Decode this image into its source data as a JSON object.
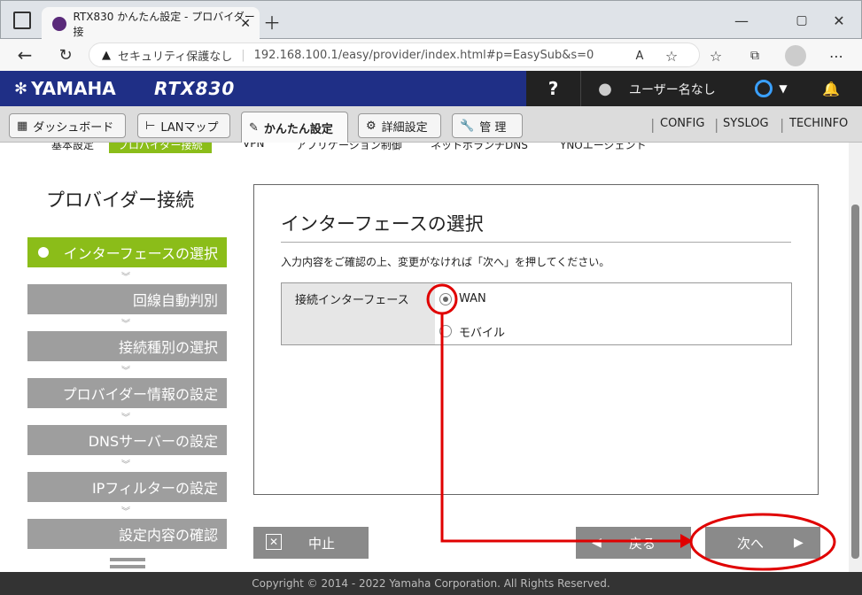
{
  "browser": {
    "tab_title": "RTX830 かんたん設定 - プロバイダー接",
    "security_label": "セキュリティ保護なし",
    "url": "192.168.100.1/easy/provider/index.html#p=EasySub&s=0"
  },
  "header": {
    "brand": "YAMAHA",
    "model": "RTX830",
    "help": "?",
    "user": "ユーザー名なし"
  },
  "nav": {
    "dashboard": "ダッシュボード",
    "lanmap": "LANマップ",
    "easy": "かんたん設定",
    "detail": "詳細設定",
    "manage": "管 理",
    "config": "CONFIG",
    "syslog": "SYSLOG",
    "techinfo": "TECHINFO"
  },
  "subnav": [
    "基本設定",
    "プロバイダー接続",
    "VPN",
    "アプリケーション制御",
    "ネットボランチDNS",
    "YNOエージェント"
  ],
  "sidebar": {
    "title": "プロバイダー接続",
    "steps": [
      "インターフェースの選択",
      "回線自動判別",
      "接続種別の選択",
      "プロバイダー情報の設定",
      "DNSサーバーの設定",
      "IPフィルターの設定",
      "設定内容の確認"
    ]
  },
  "panel": {
    "title": "インターフェースの選択",
    "desc": "入力内容をご確認の上、変更がなければ「次へ」を押してください。",
    "field_label": "接続インターフェース",
    "options": [
      "WAN",
      "モバイル"
    ],
    "selected": "WAN"
  },
  "buttons": {
    "cancel": "中止",
    "back": "戻る",
    "next": "次へ"
  },
  "footer": "Copyright © 2014 - 2022 Yamaha Corporation. All Rights Reserved.",
  "colors": {
    "header": "#1f2f86",
    "current_step": "#8bbd19",
    "annotation": "#e00000"
  }
}
